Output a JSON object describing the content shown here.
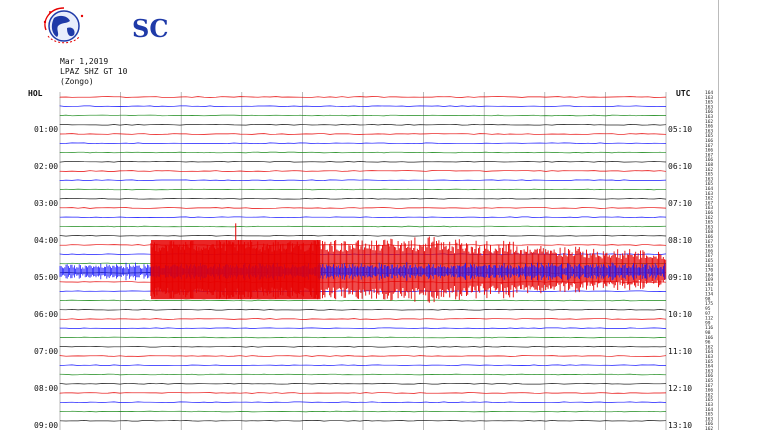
{
  "logo": {
    "text": "SC"
  },
  "station": {
    "date": "Mar 1,2019",
    "channel": "LPAZ SHZ GT 10",
    "location": "(Zongo)"
  },
  "axes": {
    "left_header": "HOL",
    "right_header": "UTC"
  },
  "colors": {
    "trace_red": "#e60000",
    "trace_blue": "#1a1aff",
    "trace_green": "#1a8a1a",
    "trace_black": "#222222",
    "grid": "#9a9a9a"
  },
  "chart_data": {
    "type": "line",
    "title": "",
    "left_ticks": [
      "01:00",
      "02:00",
      "03:00",
      "04:00",
      "05:00",
      "06:00",
      "07:00",
      "08:00",
      "09:00"
    ],
    "right_ticks": [
      "05:10",
      "06:10",
      "07:10",
      "08:10",
      "09:10",
      "10:10",
      "11:10",
      "12:10",
      "13:10"
    ],
    "hours_shown": 9,
    "traces_per_hour": 4,
    "vertical_gridlines": 11,
    "scale_column": [
      "164",
      "163",
      "165",
      "163",
      "166",
      "163",
      "162",
      "166",
      "163",
      "165",
      "166",
      "167",
      "166",
      "167",
      "166",
      "168",
      "162",
      "165",
      "163",
      "165",
      "164",
      "163",
      "162",
      "167",
      "163",
      "166",
      "162",
      "165",
      "163",
      "168",
      "166",
      "167",
      "163",
      "166",
      "167",
      "165",
      "163",
      "170",
      "164",
      "169",
      "193",
      "171",
      "134",
      "98",
      "175",
      "95",
      "97",
      "112",
      "99",
      "116",
      "98",
      "166",
      "96",
      "162",
      "164",
      "163",
      "165",
      "164",
      "163",
      "166",
      "165",
      "167",
      "166",
      "162",
      "165",
      "163",
      "164",
      "165",
      "163",
      "166",
      "162",
      "165"
    ],
    "event_segments": [
      {
        "start_hour": 4.0,
        "end_hour": 5.6,
        "color": "red",
        "level": "high amplitude",
        "x_start_fraction": 0.15,
        "x_end_fraction": 1.0
      },
      {
        "start_hour": 4.6,
        "end_hour": 5.1,
        "color": "blue",
        "level": "high amplitude",
        "x_start_fraction": 0.0,
        "x_end_fraction": 1.0
      }
    ]
  }
}
